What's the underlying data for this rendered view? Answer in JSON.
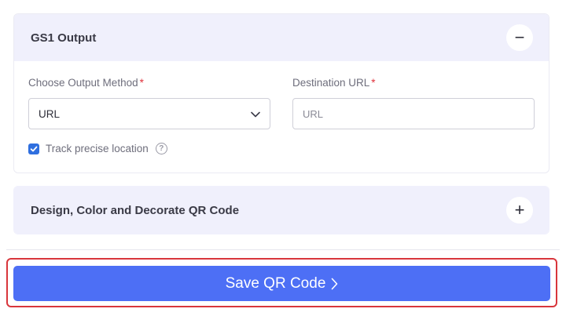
{
  "gs1_panel": {
    "title": "GS1 Output",
    "toggle_symbol": "−",
    "method_label": "Choose Output Method",
    "required_mark": "*",
    "method_value": "URL",
    "destination_label": "Destination URL",
    "destination_placeholder": "URL",
    "track_label": "Track precise location",
    "track_checked": true,
    "help_symbol": "?"
  },
  "design_panel": {
    "title": "Design, Color and Decorate QR Code",
    "toggle_symbol": "+"
  },
  "save_button": {
    "label": "Save QR Code"
  },
  "colors": {
    "accent": "#4d6ff5",
    "panel_header_bg": "#f0f0fc",
    "highlight_border": "#d8363c",
    "required": "#e0323c",
    "checkbox": "#2f6fdf"
  },
  "icons": [
    "minus-icon",
    "chevron-down-icon",
    "checkmark-icon",
    "help-icon",
    "plus-icon",
    "chevron-right-icon"
  ]
}
